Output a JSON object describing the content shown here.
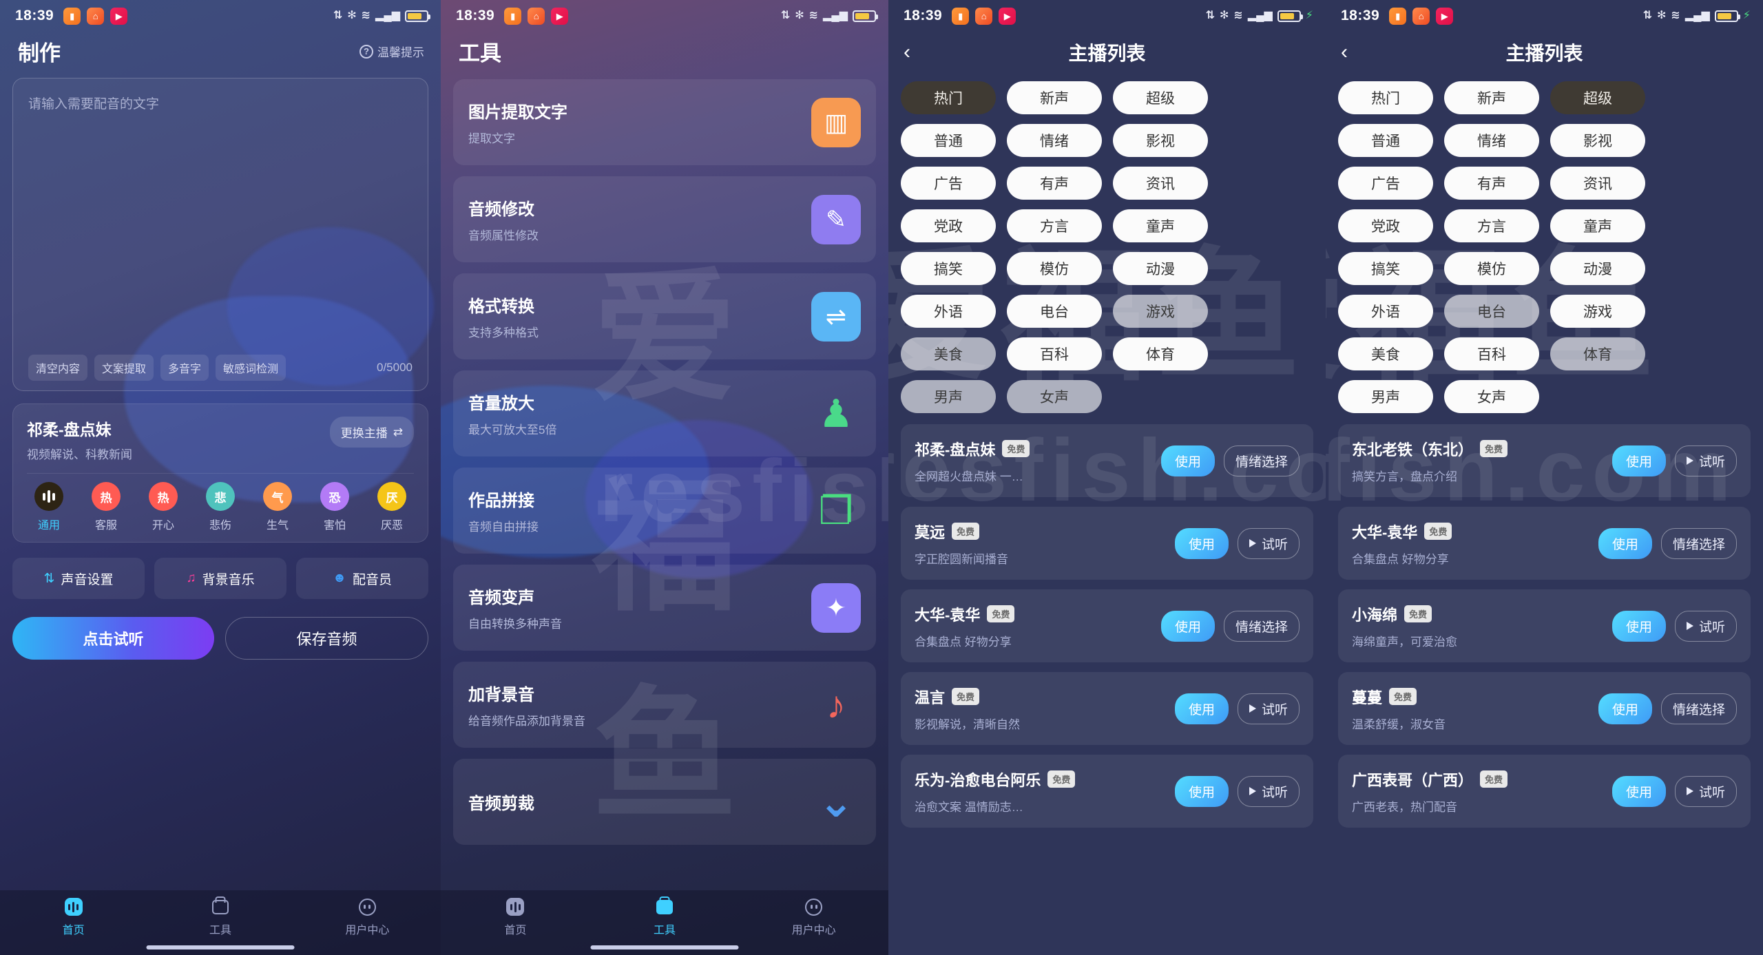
{
  "status_bar": {
    "time": "18:39",
    "app_icons": [
      "book-app-icon",
      "umbrella-app-icon",
      "video-app-icon"
    ],
    "right_icons": [
      "sync-icon",
      "bluetooth-icon",
      "wifi-icon",
      "signal-icon"
    ],
    "battery": "charging"
  },
  "watermark": {
    "big": "爱福鱼",
    "url": "resfish.com"
  },
  "panel_make": {
    "title": "制作",
    "tip_label": "温馨提示",
    "editor": {
      "placeholder": "请输入需要配音的文字",
      "counter": "0/5000",
      "tools": [
        "清空内容",
        "文案提取",
        "多音字",
        "敏感词检测"
      ]
    },
    "voice_card": {
      "name": "祁柔-盘点妹",
      "tags": "视频解说、科教新闻",
      "switch_label": "更换主播",
      "emotions": [
        {
          "label": "通用",
          "glyph": "",
          "color": "#2d2414",
          "active": true
        },
        {
          "label": "客服",
          "glyph": "热",
          "color": "#ff5b53",
          "active": false
        },
        {
          "label": "开心",
          "glyph": "热",
          "color": "#ff5b53",
          "active": false
        },
        {
          "label": "悲伤",
          "glyph": "悲",
          "color": "#4fc3bd",
          "active": false
        },
        {
          "label": "生气",
          "glyph": "气",
          "color": "#ff9a4d",
          "active": false
        },
        {
          "label": "害怕",
          "glyph": "恐",
          "color": "#b37bf6",
          "active": false
        },
        {
          "label": "厌恶",
          "glyph": "厌",
          "color": "#f5c518",
          "active": false
        }
      ]
    },
    "quick_actions": [
      {
        "label": "声音设置",
        "icon": "sliders-icon",
        "color": "#3fd0ff"
      },
      {
        "label": "背景音乐",
        "icon": "music-note-icon",
        "color": "#ff3d9a"
      },
      {
        "label": "配音员",
        "icon": "person-icon",
        "color": "#3f9bf6"
      }
    ],
    "primary_button": "点击试听",
    "secondary_button": "保存音频"
  },
  "panel_tools": {
    "title": "工具",
    "items": [
      {
        "name": "图片提取文字",
        "desc": "提取文字",
        "icon": "image-icon",
        "color": "#f79a52"
      },
      {
        "name": "音频修改",
        "desc": "音频属性修改",
        "icon": "pencil-icon",
        "color": "#8f7cf0"
      },
      {
        "name": "格式转换",
        "desc": "支持多种格式",
        "icon": "convert-icon",
        "color": "#5ab6f5"
      },
      {
        "name": "音量放大",
        "desc": "最大可放大至5倍",
        "icon": "bell-icon",
        "color": "#4ad98a"
      },
      {
        "name": "作品拼接",
        "desc": "音频自由拼接",
        "icon": "chat-bubbles-icon",
        "color": "#4ade80"
      },
      {
        "name": "音频变声",
        "desc": "自由转换多种声音",
        "icon": "magic-wand-icon",
        "color": "#8b7cf6"
      },
      {
        "name": "加背景音",
        "desc": "给音频作品添加背景音",
        "icon": "add-music-icon",
        "color": "#f4665c"
      },
      {
        "name": "音频剪裁",
        "desc": "",
        "icon": "chevron-down-icon",
        "color": "#4f9bf0"
      }
    ]
  },
  "panel_anchors_a": {
    "nav_title": "主播列表",
    "back_icon": "chevron-left-icon",
    "categories": [
      {
        "label": "热门",
        "state": "selected"
      },
      {
        "label": "新声",
        "state": "normal"
      },
      {
        "label": "超级",
        "state": "normal"
      },
      {
        "label": "普通",
        "state": "normal"
      },
      {
        "label": "情绪",
        "state": "normal"
      },
      {
        "label": "影视",
        "state": "normal"
      },
      {
        "label": "广告",
        "state": "normal"
      },
      {
        "label": "有声",
        "state": "normal"
      },
      {
        "label": "资讯",
        "state": "normal"
      },
      {
        "label": "党政",
        "state": "normal"
      },
      {
        "label": "方言",
        "state": "normal"
      },
      {
        "label": "童声",
        "state": "normal"
      },
      {
        "label": "搞笑",
        "state": "normal"
      },
      {
        "label": "模仿",
        "state": "normal"
      },
      {
        "label": "动漫",
        "state": "normal"
      },
      {
        "label": "外语",
        "state": "normal"
      },
      {
        "label": "电台",
        "state": "normal"
      },
      {
        "label": "游戏",
        "state": "dim"
      },
      {
        "label": "美食",
        "state": "dim"
      },
      {
        "label": "百科",
        "state": "normal"
      },
      {
        "label": "体育",
        "state": "normal"
      },
      {
        "label": "男声",
        "state": "dim"
      },
      {
        "label": "女声",
        "state": "dim"
      }
    ],
    "badge_label": "免费",
    "use_label": "使用",
    "items": [
      {
        "name": "祁柔-盘点妹",
        "desc": "全网超火盘点妹 一…",
        "action": "情绪选择",
        "action_icon": "none"
      },
      {
        "name": "莫远",
        "desc": "字正腔圆新闻播音",
        "action": "试听",
        "action_icon": "play-icon"
      },
      {
        "name": "大华-袁华",
        "desc": "合集盘点 好物分享",
        "action": "情绪选择",
        "action_icon": "none"
      },
      {
        "name": "温言",
        "desc": "影视解说，清晰自然",
        "action": "试听",
        "action_icon": "play-icon"
      },
      {
        "name": "乐为-治愈电台阿乐",
        "desc": "治愈文案 温情励志…",
        "action": "试听",
        "action_icon": "play-icon"
      }
    ]
  },
  "panel_anchors_b": {
    "nav_title": "主播列表",
    "back_icon": "chevron-left-icon",
    "categories": [
      {
        "label": "热门",
        "state": "normal"
      },
      {
        "label": "新声",
        "state": "normal"
      },
      {
        "label": "超级",
        "state": "selected"
      },
      {
        "label": "普通",
        "state": "normal"
      },
      {
        "label": "情绪",
        "state": "normal"
      },
      {
        "label": "影视",
        "state": "normal"
      },
      {
        "label": "广告",
        "state": "normal"
      },
      {
        "label": "有声",
        "state": "normal"
      },
      {
        "label": "资讯",
        "state": "normal"
      },
      {
        "label": "党政",
        "state": "normal"
      },
      {
        "label": "方言",
        "state": "normal"
      },
      {
        "label": "童声",
        "state": "normal"
      },
      {
        "label": "搞笑",
        "state": "normal"
      },
      {
        "label": "模仿",
        "state": "normal"
      },
      {
        "label": "动漫",
        "state": "normal"
      },
      {
        "label": "外语",
        "state": "normal"
      },
      {
        "label": "电台",
        "state": "dim"
      },
      {
        "label": "游戏",
        "state": "normal"
      },
      {
        "label": "美食",
        "state": "normal"
      },
      {
        "label": "百科",
        "state": "normal"
      },
      {
        "label": "体育",
        "state": "dim"
      },
      {
        "label": "男声",
        "state": "normal"
      },
      {
        "label": "女声",
        "state": "normal"
      }
    ],
    "badge_label": "免费",
    "use_label": "使用",
    "items": [
      {
        "name": "东北老铁（东北）",
        "desc": "搞笑方言，盘点介绍",
        "action": "试听",
        "action_icon": "play-icon"
      },
      {
        "name": "大华-袁华",
        "desc": "合集盘点 好物分享",
        "action": "情绪选择",
        "action_icon": "none"
      },
      {
        "name": "小海绵",
        "desc": "海绵童声，可爱治愈",
        "action": "试听",
        "action_icon": "play-icon"
      },
      {
        "name": "蔓蔓",
        "desc": "温柔舒缓，淑女音",
        "action": "情绪选择",
        "action_icon": "none"
      },
      {
        "name": "广西表哥（广西）",
        "desc": "广西老表，热门配音",
        "action": "试听",
        "action_icon": "play-icon"
      }
    ]
  },
  "tabbar": {
    "items": [
      {
        "label": "首页",
        "icon": "home-wave-icon"
      },
      {
        "label": "工具",
        "icon": "toolbox-icon"
      },
      {
        "label": "用户中心",
        "icon": "user-face-icon"
      }
    ]
  }
}
